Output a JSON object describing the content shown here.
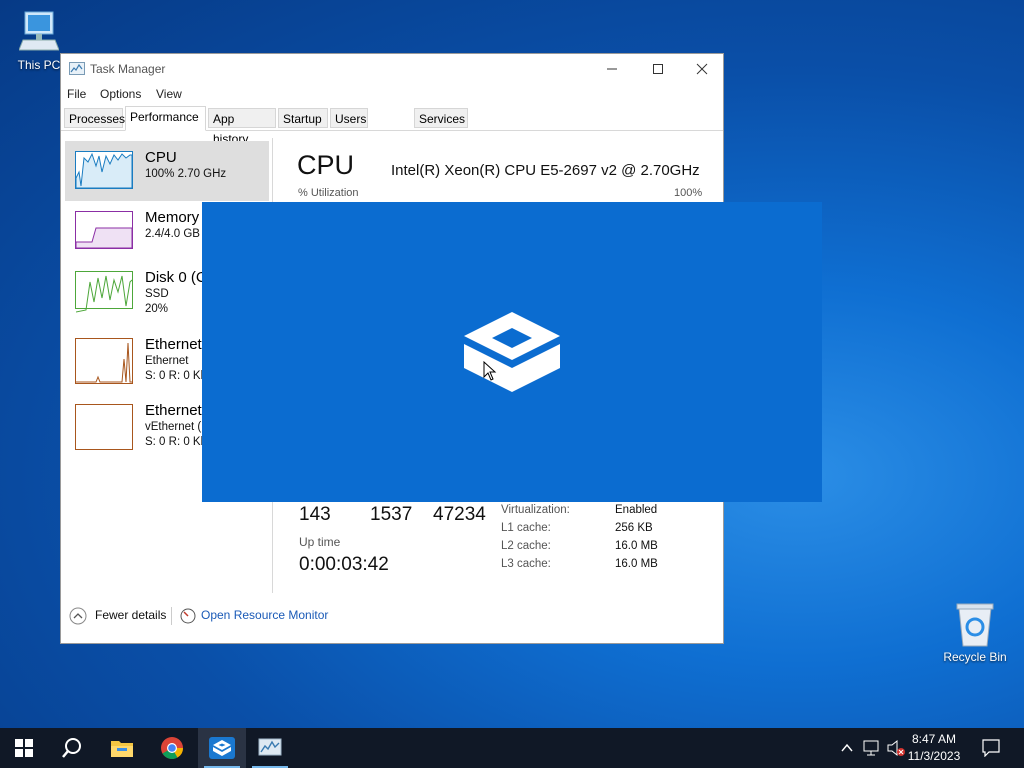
{
  "desktop": {
    "this_pc_label": "This PC",
    "recycle_bin_label": "Recycle Bin"
  },
  "task_manager": {
    "title": "Task Manager",
    "menu": [
      "File",
      "Options",
      "View"
    ],
    "tabs": [
      "Processes",
      "Performance",
      "App history",
      "Startup",
      "Users",
      "Services"
    ],
    "active_tab": "Performance",
    "sidebar": [
      {
        "name": "CPU",
        "sub1": "100%  2.70 GHz",
        "sub2": "",
        "color": "#1a7cc1"
      },
      {
        "name": "Memory",
        "sub1": "2.4/4.0 GB",
        "sub2": "",
        "color": "#8b2ea5"
      },
      {
        "name": "Disk 0 (C",
        "sub1": "SSD",
        "sub2": "20%",
        "color": "#4da73a"
      },
      {
        "name": "Ethernet",
        "sub1": "Ethernet",
        "sub2": "S: 0 R: 0 Kb",
        "color": "#a8561d"
      },
      {
        "name": "Ethernet",
        "sub1": "vEthernet (",
        "sub2": "S: 0 R: 0 Kb",
        "color": "#a8561d"
      }
    ],
    "main": {
      "heading": "CPU",
      "model": "Intel(R) Xeon(R) CPU E5-2697 v2 @ 2.70GHz",
      "util_label": "% Utilization",
      "util_max": "100%",
      "stats": [
        "143",
        "1537",
        "47234"
      ],
      "uptime_label": "Up time",
      "uptime_value": "0:00:03:42",
      "details": [
        {
          "k": "Virtualization:",
          "v": "Enabled"
        },
        {
          "k": "L1 cache:",
          "v": "256 KB"
        },
        {
          "k": "L2 cache:",
          "v": "16.0 MB"
        },
        {
          "k": "L3 cache:",
          "v": "16.0 MB"
        }
      ]
    },
    "footer": {
      "fewer_details": "Fewer details",
      "open_resource_monitor": "Open Resource Monitor"
    }
  },
  "taskbar": {
    "time": "8:47 AM",
    "date": "11/3/2023",
    "items": [
      "start-icon",
      "search-icon",
      "file-explorer-icon",
      "chrome-icon",
      "sandbox-icon",
      "task-manager-icon"
    ]
  }
}
